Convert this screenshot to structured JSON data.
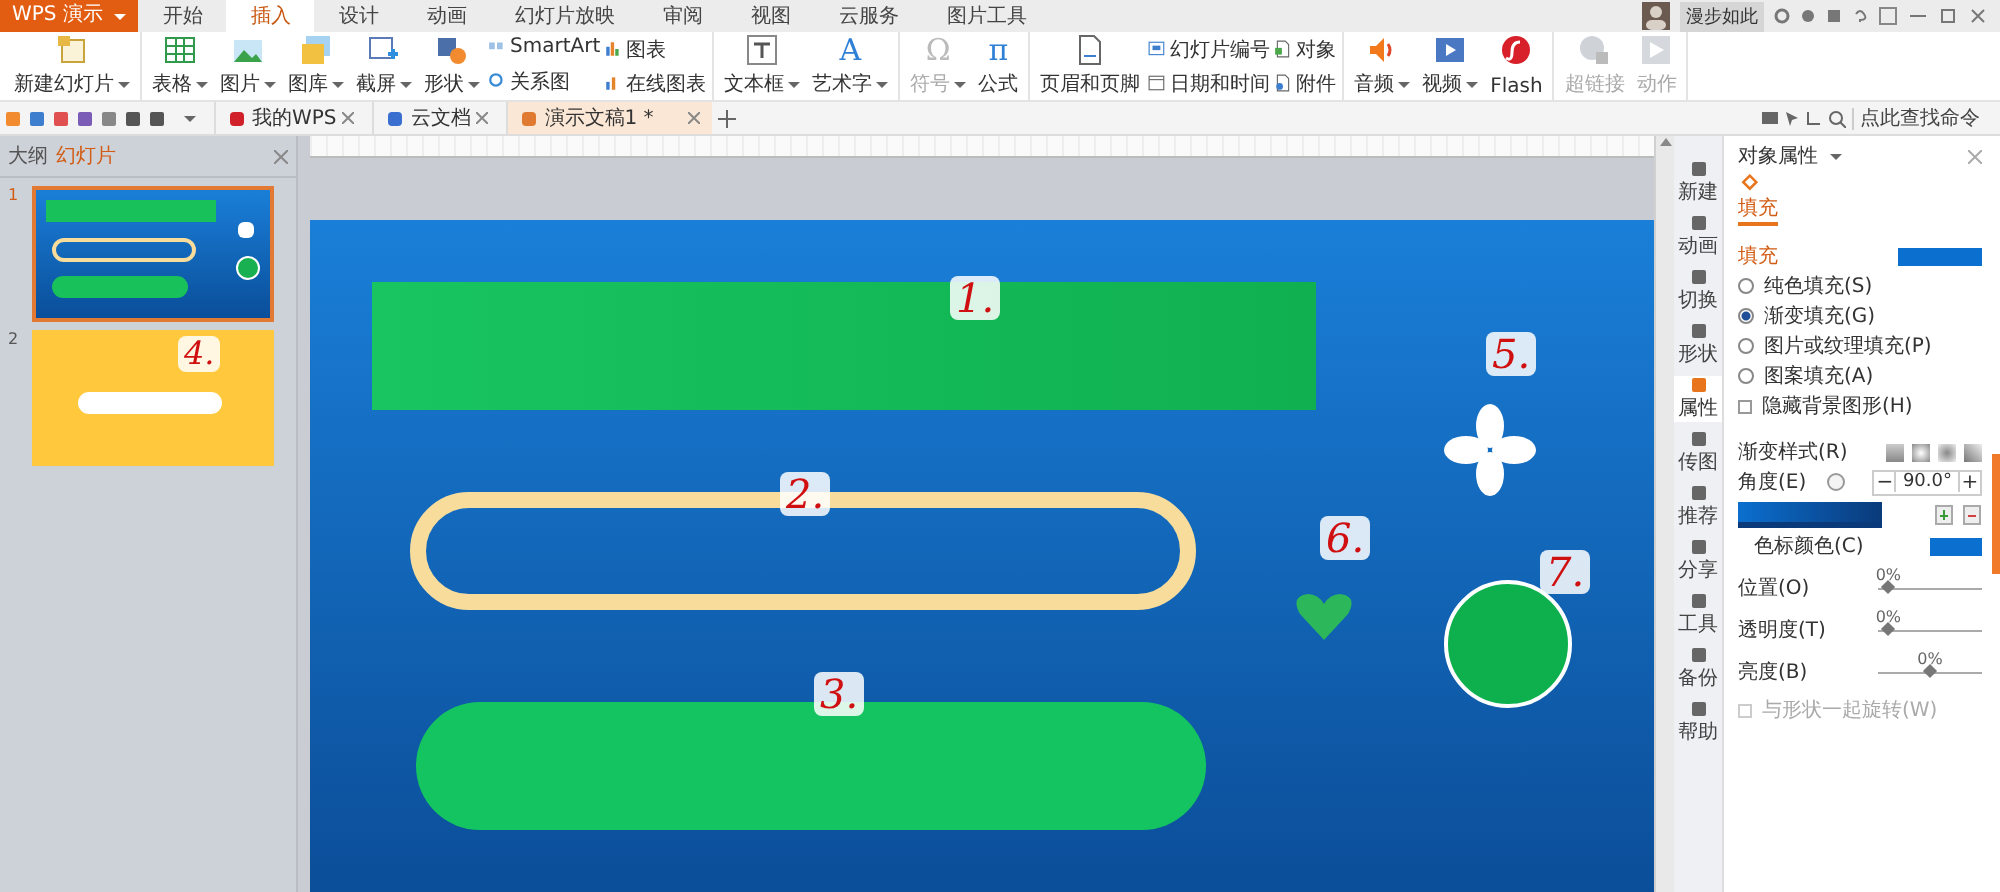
{
  "app_button": {
    "label": "WPS 演示"
  },
  "menu_tabs": [
    {
      "label": "开始",
      "selected": false
    },
    {
      "label": "插入",
      "selected": true
    },
    {
      "label": "设计",
      "selected": false
    },
    {
      "label": "动画",
      "selected": false
    },
    {
      "label": "幻灯片放映",
      "selected": false
    },
    {
      "label": "审阅",
      "selected": false
    },
    {
      "label": "视图",
      "selected": false
    },
    {
      "label": "云服务",
      "selected": false
    },
    {
      "label": "图片工具",
      "selected": false
    }
  ],
  "user": {
    "name": "漫步如此"
  },
  "ribbon_groups": [
    [
      {
        "kind": "large",
        "label": "新建幻灯片",
        "dropdown": true,
        "disabled": false
      }
    ],
    [
      {
        "kind": "large",
        "label": "表格",
        "dropdown": true,
        "disabled": false
      },
      {
        "kind": "large",
        "label": "图片",
        "dropdown": true,
        "disabled": false
      },
      {
        "kind": "large",
        "label": "图库",
        "dropdown": true,
        "disabled": false
      },
      {
        "kind": "large",
        "label": "截屏",
        "dropdown": true,
        "disabled": false
      },
      {
        "kind": "large",
        "label": "形状",
        "dropdown": true,
        "disabled": false
      },
      {
        "kind": "stack",
        "items": [
          {
            "label": "SmartArt",
            "disabled": false
          },
          {
            "label": "关系图",
            "disabled": false
          }
        ]
      },
      {
        "kind": "stack",
        "items": [
          {
            "label": "图表",
            "disabled": false
          },
          {
            "label": "在线图表",
            "disabled": false
          }
        ]
      }
    ],
    [
      {
        "kind": "large",
        "label": "文本框",
        "dropdown": true,
        "disabled": false
      },
      {
        "kind": "large",
        "label": "艺术字",
        "dropdown": true,
        "disabled": false,
        "glyph": "A"
      }
    ],
    [
      {
        "kind": "large",
        "label": "符号",
        "dropdown": true,
        "disabled": true,
        "glyph": "Ω"
      },
      {
        "kind": "large",
        "label": "公式",
        "dropdown": false,
        "disabled": false,
        "glyph": "π"
      }
    ],
    [
      {
        "kind": "large",
        "label": "页眉和页脚",
        "dropdown": false,
        "disabled": false
      },
      {
        "kind": "stack",
        "items": [
          {
            "label": "幻灯片编号",
            "disabled": false
          },
          {
            "label": "日期和时间",
            "disabled": false
          }
        ]
      },
      {
        "kind": "stack",
        "items": [
          {
            "label": "对象",
            "disabled": false
          },
          {
            "label": "附件",
            "disabled": false
          }
        ]
      }
    ],
    [
      {
        "kind": "large",
        "label": "音频",
        "dropdown": true,
        "disabled": false
      },
      {
        "kind": "large",
        "label": "视频",
        "dropdown": true,
        "disabled": false
      },
      {
        "kind": "large",
        "label": "Flash",
        "dropdown": false,
        "disabled": false
      }
    ],
    [
      {
        "kind": "large",
        "label": "超链接",
        "dropdown": false,
        "disabled": true
      },
      {
        "kind": "large",
        "label": "动作",
        "dropdown": false,
        "disabled": true
      }
    ]
  ],
  "doc_tabs": [
    {
      "label": "我的WPS",
      "selected": false
    },
    {
      "label": "云文档",
      "selected": false
    },
    {
      "label": "演示文稿1 *",
      "selected": true
    }
  ],
  "command_search": {
    "placeholder": "点此查找命令"
  },
  "left_panel": {
    "tabs": [
      {
        "label": "大纲",
        "selected": false
      },
      {
        "label": "幻灯片",
        "selected": true
      }
    ],
    "slides": [
      {
        "number": "1",
        "selected": true
      },
      {
        "number": "2",
        "selected": false,
        "annotation": "4."
      }
    ]
  },
  "slide_annotations": [
    "1.",
    "2.",
    "3.",
    "5.",
    "6.",
    "7."
  ],
  "side_strip": [
    {
      "label": "新建",
      "selected": false
    },
    {
      "label": "动画",
      "selected": false
    },
    {
      "label": "切换",
      "selected": false
    },
    {
      "label": "形状",
      "selected": false
    },
    {
      "label": "属性",
      "selected": true
    },
    {
      "label": "传图",
      "selected": false
    },
    {
      "label": "推荐",
      "selected": false
    },
    {
      "label": "分享",
      "selected": false
    },
    {
      "label": "工具",
      "selected": false
    },
    {
      "label": "备份",
      "selected": false
    },
    {
      "label": "帮助",
      "selected": false
    }
  ],
  "properties": {
    "title": "对象属性",
    "tab": "填充",
    "section": "填充",
    "fill_options": [
      {
        "label": "纯色填充(S)",
        "selected": false
      },
      {
        "label": "渐变填充(G)",
        "selected": true
      },
      {
        "label": "图片或纹理填充(P)",
        "selected": false
      },
      {
        "label": "图案填充(A)",
        "selected": false
      }
    ],
    "hide_background": {
      "label": "隐藏背景图形(H)",
      "checked": false
    },
    "gradient_style": {
      "label": "渐变样式(R)"
    },
    "angle": {
      "label": "角度(E)",
      "value": "90.0°",
      "minus": "−",
      "plus": "+"
    },
    "stop_color": {
      "label": "色标颜色(C)"
    },
    "sliders": [
      {
        "label": "位置(O)",
        "reading": "0%",
        "level": 0.1
      },
      {
        "label": "透明度(T)",
        "reading": "0%",
        "level": 0.1
      },
      {
        "label": "亮度(B)",
        "reading": "0%",
        "level": 0.5
      }
    ],
    "rotate_with_shape": {
      "label": "与形状一起旋转(W)",
      "checked": false,
      "disabled": true
    }
  }
}
